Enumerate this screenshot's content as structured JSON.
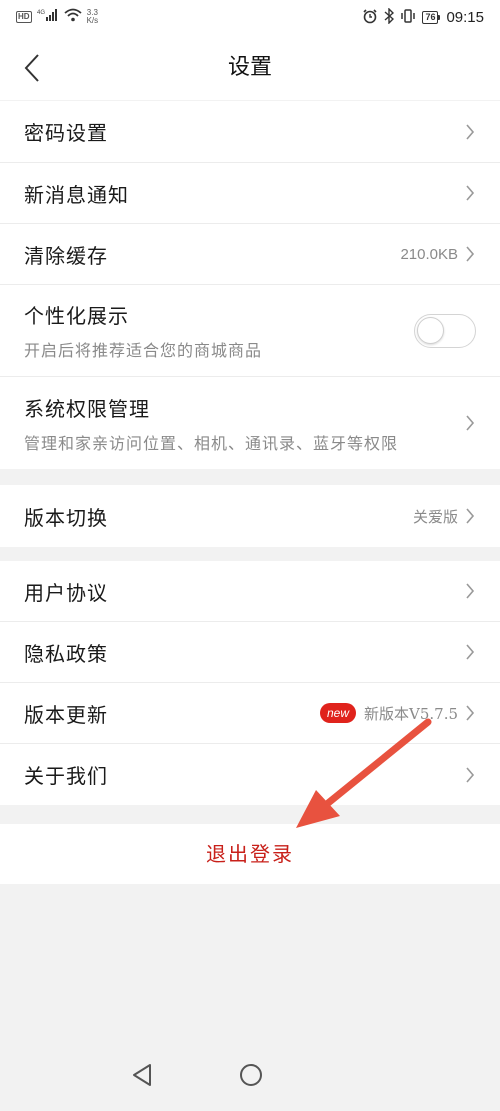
{
  "status_bar": {
    "hd_label": "HD",
    "signal_label": "4G",
    "speed_value": "3.3",
    "speed_unit": "K/s",
    "battery": "76",
    "time": "09:15"
  },
  "header": {
    "title": "设置"
  },
  "group1": [
    {
      "title": "密码设置"
    },
    {
      "title": "新消息通知"
    },
    {
      "title": "清除缓存",
      "value": "210.0KB"
    },
    {
      "title": "个性化展示",
      "subtitle": "开启后将推荐适合您的商城商品",
      "toggle_on": false
    },
    {
      "title": "系统权限管理",
      "subtitle": "管理和家亲访问位置、相机、通讯录、蓝牙等权限"
    }
  ],
  "group2": [
    {
      "title": "版本切换",
      "value": "关爱版"
    }
  ],
  "group3": [
    {
      "title": "用户协议"
    },
    {
      "title": "隐私政策"
    },
    {
      "title": "版本更新",
      "badge": "new",
      "value": "新版本V5.7.5"
    },
    {
      "title": "关于我们"
    }
  ],
  "logout_label": "退出登录",
  "colors": {
    "accent": "#c8201a",
    "badge": "#e0231c",
    "annotation_arrow": "#e8523f"
  },
  "icons": {
    "back": "chevron-left-icon",
    "row_arrow": "chevron-right-icon",
    "sys_back": "triangle-back-icon",
    "sys_home": "circle-home-icon"
  }
}
